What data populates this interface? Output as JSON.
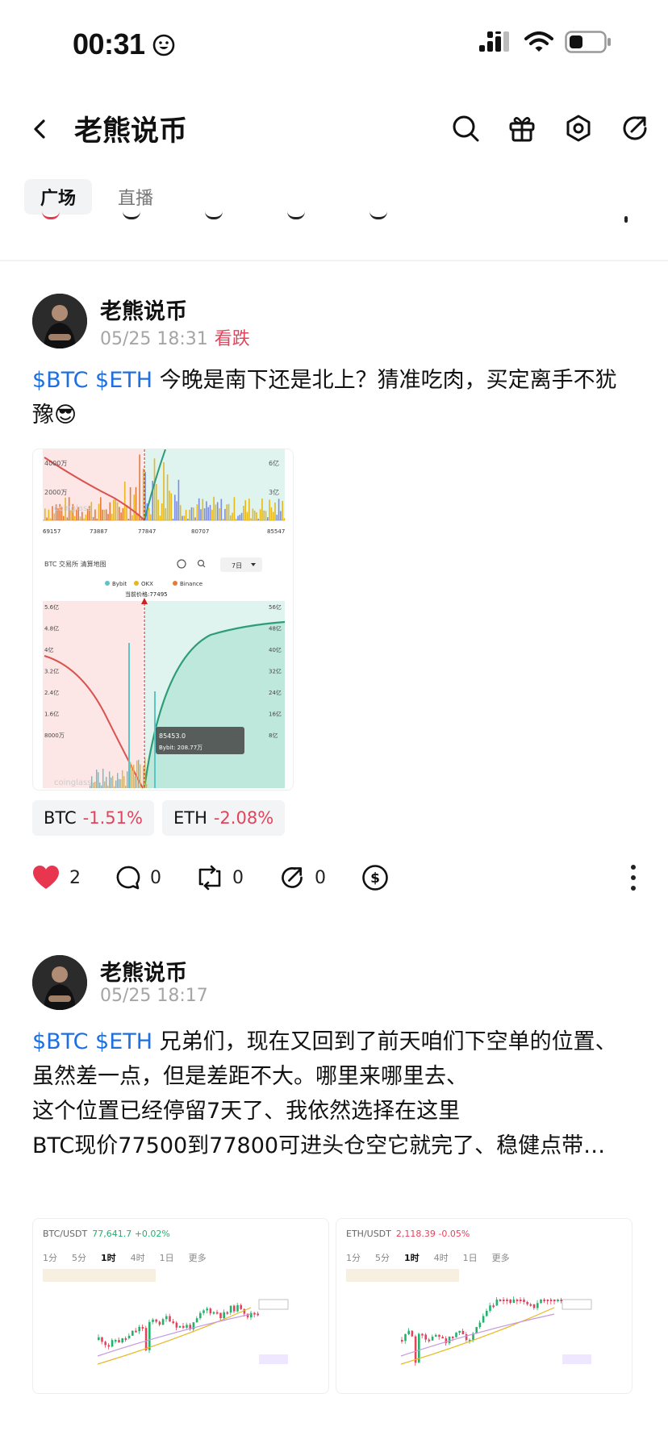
{
  "status_bar": {
    "time": "00:31"
  },
  "header": {
    "title": "老熊说币"
  },
  "tabs": [
    {
      "label": "广场",
      "active": true
    },
    {
      "label": "直播",
      "active": false
    }
  ],
  "posts": [
    {
      "author": "老熊说币",
      "time": "05/25 18:31",
      "sentiment": "看跌",
      "tickers": "$BTC $ETH",
      "text": " 今晚是南下还是北上？猜准吃肉，买定离手不犹豫😎",
      "chart": {
        "top_y_left": [
          "4000万",
          "2000万"
        ],
        "top_y_right": [
          "6亿",
          "3亿"
        ],
        "top_x": [
          "69157",
          "73887",
          "77847",
          "80707",
          "85547"
        ],
        "panel_title": "BTC 交易所 清算地图",
        "range": "7日",
        "legend": [
          "Bybit",
          "OKX",
          "Binance"
        ],
        "current_price": "当前价格:77495",
        "left_axis": [
          "5.6亿",
          "4.8亿",
          "4亿",
          "3.2亿",
          "2.4亿",
          "1.6亿",
          "8000万"
        ],
        "right_axis": [
          "56亿",
          "48亿",
          "40亿",
          "32亿",
          "24亿",
          "16亿",
          "8亿"
        ],
        "tooltip_price": "85453.0",
        "tooltip_line": "Bybit: 208.77万",
        "watermark": "coinglass"
      },
      "coins": [
        {
          "symbol": "BTC",
          "change": "-1.51%"
        },
        {
          "symbol": "ETH",
          "change": "-2.08%"
        }
      ],
      "likes": "2",
      "comments": "0",
      "reposts": "0",
      "shares": "0"
    },
    {
      "author": "老熊说币",
      "time": "05/25 18:17",
      "tickers": "$BTC $ETH",
      "lines": [
        " 兄弟们，现在又回到了前天咱们下空单的位置、",
        "虽然差一点，但是差距不大。哪里来哪里去、",
        "这个位置已经停留7天了、我依然选择在这里",
        "BTC现价77500到77800可进头仓空它就完了、稳健点带…"
      ],
      "images": [
        {
          "pair": "BTC/USDT",
          "price": "77,641.7 +0.02%",
          "tf": [
            "1分",
            "5分",
            "1时",
            "4时",
            "1日",
            "更多"
          ],
          "active": "1时"
        },
        {
          "pair": "ETH/USDT",
          "price": "2,118.39 -0.05%",
          "tf": [
            "1分",
            "5分",
            "1时",
            "4时",
            "1日",
            "更多"
          ],
          "active": "1时"
        }
      ]
    }
  ],
  "colors": {
    "accent_blue": "#1f6fe0",
    "down_red": "#e2445c",
    "like_red": "#e8364f"
  }
}
